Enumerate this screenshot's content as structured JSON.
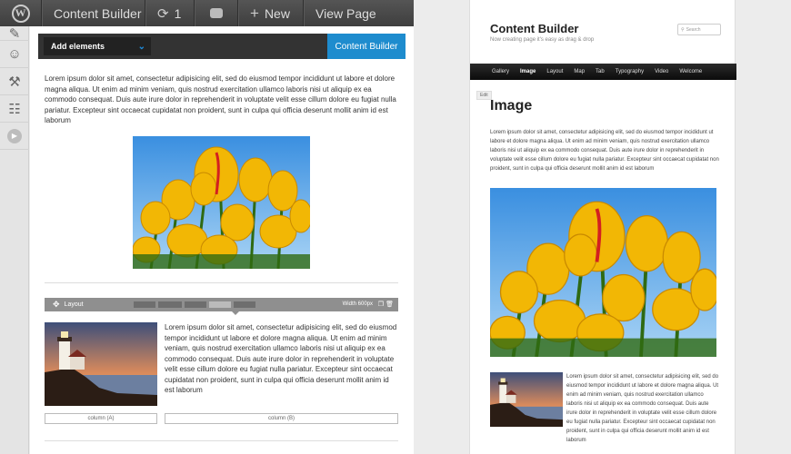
{
  "adminbar": {
    "wp_logo": "W",
    "site_name": "Content Builder",
    "updates_count": "1",
    "new_label": "New",
    "view_page_label": "View Page",
    "icons": [
      "wordpress-icon",
      "refresh-icon",
      "comment-icon",
      "plus-icon"
    ]
  },
  "sidebar": {
    "icons": [
      "comments-icon",
      "users-icon",
      "tools-icon",
      "settings-icon",
      "collapse-icon"
    ]
  },
  "editor": {
    "add_elements_label": "Add elements",
    "content_builder_label": "Content Builder",
    "paragraph1": "Lorem ipsum dolor sit amet, consectetur adipisicing elit, sed do eiusmod tempor incididunt ut labore et dolore magna aliqua. Ut enim ad minim veniam, quis nostrud exercitation ullamco laboris nisi ut aliquip ex ea commodo consequat. Duis aute irure dolor in reprehenderit in voluptate velit esse cillum dolore eu fugiat nulla pariatur. Excepteur sint occaecat cupidatat non proident, sunt in culpa qui officia deserunt mollit anim id est laborum",
    "layout_label": "Layout",
    "width_label": "Width 600px",
    "paragraph2": "Lorem ipsum dolor sit amet, consectetur adipisicing elit, sed do eiusmod tempor incididunt ut labore et dolore magna aliqua. Ut enim ad minim veniam, quis nostrud exercitation ullamco laboris nisi ut aliquip ex ea commodo consequat. Duis aute irure dolor in reprehenderit in voluptate velit esse cillum dolore eu fugiat nulla pariatur. Excepteur sint occaecat cupidatat non proident, sunt in culpa qui officia deserunt mollit anim id est laborum",
    "column_a": "column (A)",
    "column_b": "column (B)"
  },
  "preview": {
    "site_title": "Content Builder",
    "tagline": "Now creating page it's easy as drag & drop",
    "search_placeholder": "Search",
    "nav": [
      "Gallery",
      "Image",
      "Layout",
      "Map",
      "Tab",
      "Typography",
      "Video",
      "Welcome"
    ],
    "nav_current": "Image",
    "edit_label": "Edit",
    "page_heading": "Image",
    "paragraph1": "Lorem ipsum dolor sit amet, consectetur adipisicing elit, sed do eiusmod tempor incididunt ut labore et dolore magna aliqua. Ut enim ad minim veniam, quis nostrud exercitation ullamco laboris nisi ut aliquip ex ea commodo consequat. Duis aute irure dolor in reprehenderit in voluptate velit esse cillum dolore eu fugiat nulla pariatur. Excepteur sint occaecat cupidatat non proident, sunt in culpa qui officia deserunt mollit anim id est laborum",
    "paragraph2": "Lorem ipsum dolor sit amet, consectetur adipisicing elit, sed do eiusmod tempor incididunt ut labore et dolore magna aliqua. Ut enim ad minim veniam, quis nostrud exercitation ullamco laboris nisi ut aliquip ex ea commodo consequat. Duis aute irure dolor in reprehenderit in voluptate velit esse cillum dolore eu fugiat nulla pariatur. Excepteur sint occaecat cupidatat non proident, sunt in culpa qui officia deserunt mollit anim id est laborum"
  },
  "colors": {
    "accent": "#1e8cce",
    "adminbar": "#464646",
    "layout_bar": "#8f8f8f"
  }
}
